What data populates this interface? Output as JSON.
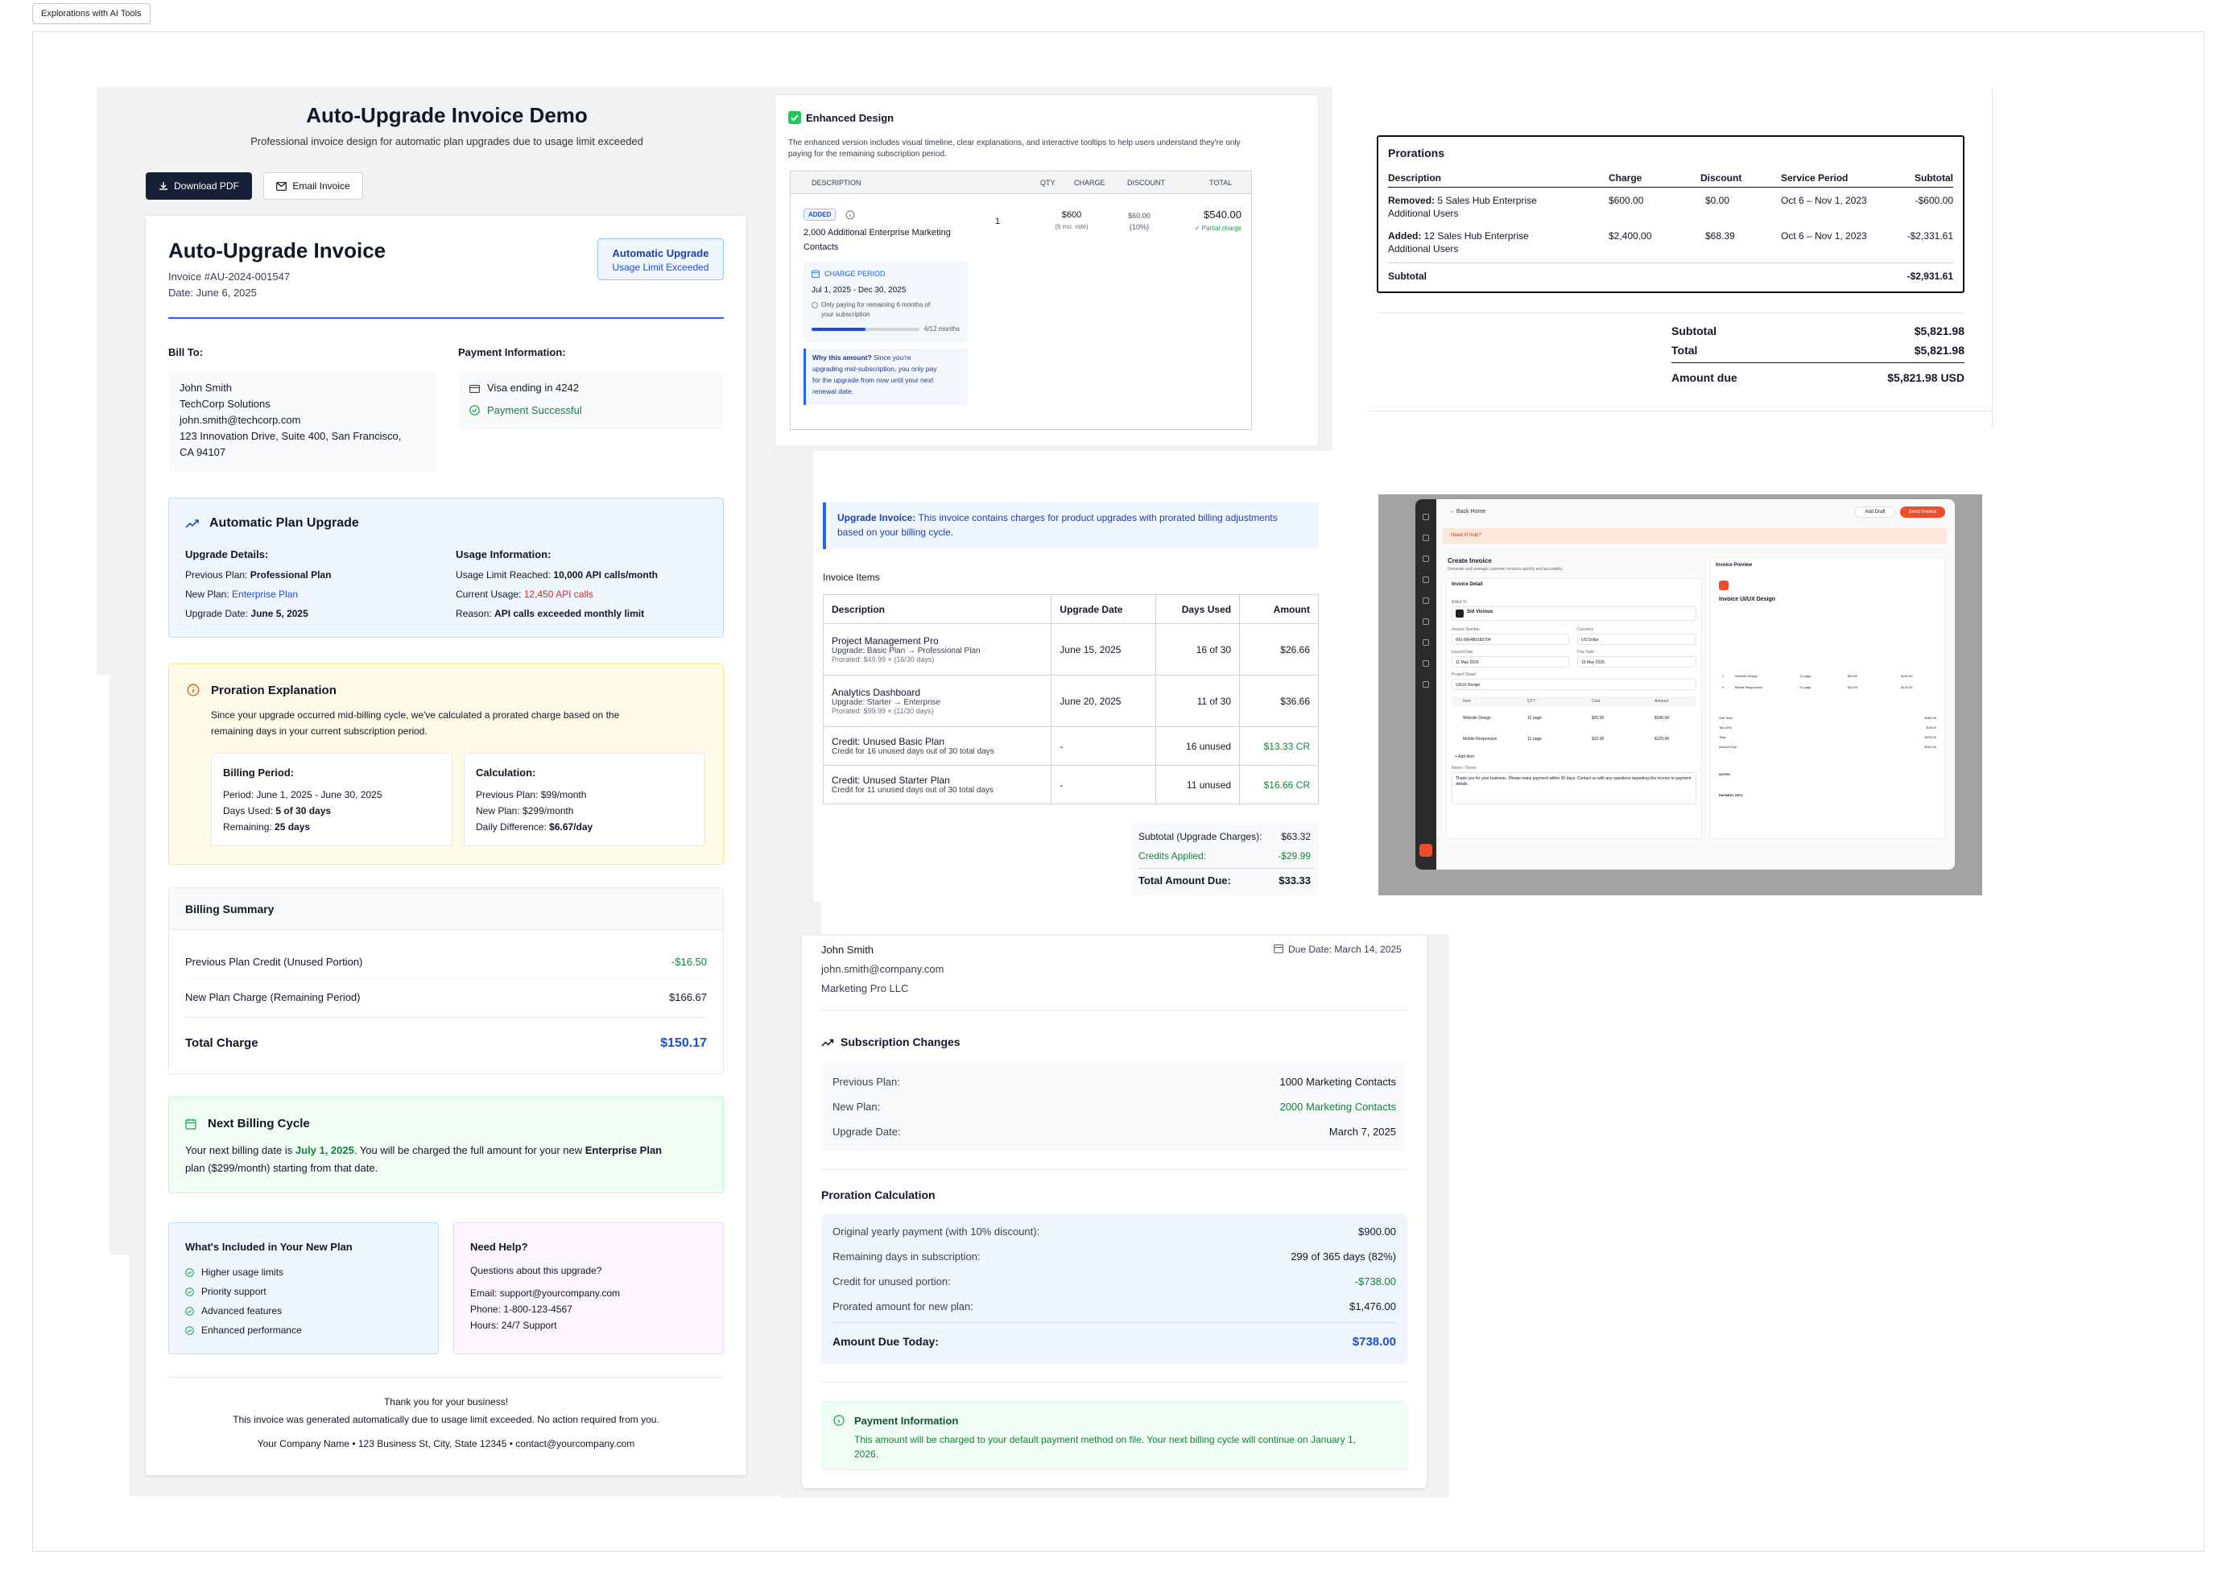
{
  "canvas": {
    "tag": "Explorations with AI Tools"
  },
  "left_invoice": {
    "demo_title": "Auto-Upgrade Invoice Demo",
    "demo_subtitle": "Professional invoice design for automatic plan upgrades due to usage limit exceeded",
    "download_label": "Download PDF",
    "email_label": "Email Invoice",
    "title": "Auto-Upgrade Invoice",
    "invoice_no": "Invoice #AU-2024-001547",
    "date": "Date: June 6, 2025",
    "badge_line1": "Automatic Upgrade",
    "badge_line2": "Usage Limit Exceeded",
    "bill_to_label": "Bill To:",
    "bill_to": [
      "John Smith",
      "TechCorp Solutions",
      "john.smith@techcorp.com",
      "123 Innovation Drive, Suite 400, San Francisco,",
      "CA 94107"
    ],
    "payment_label": "Payment Information:",
    "card": "Visa ending in 4242",
    "payment_status": "Payment Successful",
    "upgrade_title": "Automatic Plan Upgrade",
    "upgrade_details_label": "Upgrade Details:",
    "prev_plan_k": "Previous Plan:",
    "prev_plan_v": "Professional Plan",
    "new_plan_k": "New Plan:",
    "new_plan_v": "Enterprise Plan",
    "upgrade_date_k": "Upgrade Date:",
    "upgrade_date_v": "June 5, 2025",
    "usage_label": "Usage Information:",
    "limit_k": "Usage Limit Reached:",
    "limit_v": "10,000 API calls/month",
    "current_k": "Current Usage:",
    "current_v": "12,450 API calls",
    "reason_k": "Reason:",
    "reason_v": "API calls exceeded monthly limit",
    "proration_title": "Proration Explanation",
    "proration_text1": "Since your upgrade occurred mid-billing cycle, we've calculated a prorated charge based on the",
    "proration_text2": "remaining days in your current subscription period.",
    "billing_period_label": "Billing Period:",
    "period_k": "Period:",
    "period_v": "June 1, 2025 - June 30, 2025",
    "days_used_k": "Days Used:",
    "days_used_v": "5 of 30 days",
    "remaining_k": "Remaining:",
    "remaining_v": "25 days",
    "calc_label": "Calculation:",
    "calc_prev_k": "Previous Plan:",
    "calc_prev_v": "$99/month",
    "calc_new_k": "New Plan:",
    "calc_new_v": "$299/month",
    "calc_diff_k": "Daily Difference:",
    "calc_diff_v": "$6.67/day",
    "summary_title": "Billing Summary",
    "credit_k": "Previous Plan Credit (Unused Portion)",
    "credit_v": "-$16.50",
    "charge_k": "New Plan Charge (Remaining Period)",
    "charge_v": "$166.67",
    "total_k": "Total Charge",
    "total_v": "$150.17",
    "next_title": "Next Billing Cycle",
    "next_text_a": "Your next billing date is ",
    "next_date": "July 1, 2025",
    "next_text_b": ". You will be charged the full amount for your new ",
    "next_plan": "Enterprise Plan",
    "next_text_c": "plan ($299/month) starting from that date.",
    "included_title": "What's Included in Your New Plan",
    "included": [
      "Higher usage limits",
      "Priority support",
      "Advanced features",
      "Enhanced performance"
    ],
    "help_title": "Need Help?",
    "help_q": "Questions about this upgrade?",
    "help_email_k": "Email:",
    "help_email_v": "support@yourcompany.com",
    "help_phone_k": "Phone:",
    "help_phone_v": "1-800-123-4567",
    "help_hours_k": "Hours:",
    "help_hours_v": "24/7 Support",
    "thanks": "Thank you for your business!",
    "footer_note": "This invoice was generated automatically due to usage limit exceeded. No action required from you.",
    "footer_company": "Your Company Name • 123 Business St, City, State 12345 • contact@yourcompany.com"
  },
  "enhanced": {
    "title": "Enhanced Design",
    "desc1": "The enhanced version includes visual timeline, clear explanations, and interactive tooltips to help users understand they're only",
    "desc2": "paying for the remaining subscription period.",
    "headers": [
      "DESCRIPTION",
      "QTY",
      "CHARGE",
      "DISCOUNT",
      "TOTAL"
    ],
    "badge": "ADDED",
    "item1": "2,000 Additional Enterprise Marketing",
    "item2": "Contacts",
    "qty": "1",
    "charge": "$600",
    "charge_sub": "(6 mo. rate)",
    "discount": "$60.00",
    "discount_sub": "(10%)",
    "total": "$540.00",
    "partial": "✓ Partial charge",
    "period_label": "CHARGE PERIOD",
    "period": "Jul 1, 2025 - Dec 30, 2025",
    "period_note1": "Only paying for remaining 6 months of",
    "period_note2": "your subscription",
    "progress_label": "6/12 months",
    "progress": 0.5,
    "why_bold": "Why this amount?",
    "why1": " Since you're",
    "why2": "upgrading mid-subscription, you only pay",
    "why3": "for the upgrade from now until your next",
    "why4": "renewal date."
  },
  "prorations": {
    "title": "Prorations",
    "headers": [
      "Description",
      "Charge",
      "Discount",
      "Service Period",
      "Subtotal"
    ],
    "rows": [
      {
        "kind": "Removed:",
        "desc1": " 5 Sales Hub Enterprise",
        "desc2": "Additional Users",
        "charge": "$600.00",
        "discount": "$0.00",
        "period": "Oct 6 – Nov 1, 2023",
        "subtotal": "-$600.00"
      },
      {
        "kind": "Added:",
        "desc1": " 12 Sales Hub Enterprise",
        "desc2": "Additional Users",
        "charge": "$2,400.00",
        "discount": "$68.39",
        "period": "Oct 6 – Nov 1, 2023",
        "subtotal": "-$2,331.61"
      }
    ],
    "subtotal_k": "Subtotal",
    "subtotal_v": "-$2,931.61",
    "sum_subtotal_k": "Subtotal",
    "sum_subtotal_v": "$5,821.98",
    "sum_total_k": "Total",
    "sum_total_v": "$5,821.98",
    "amount_due_k": "Amount due",
    "amount_due_v": "$5,821.98 USD"
  },
  "upgrade_table": {
    "banner_bold": "Upgrade Invoice:",
    "banner1": " This invoice contains charges for product upgrades with prorated billing adjustments",
    "banner2": "based on your billing cycle.",
    "items_label": "Invoice Items",
    "headers": [
      "Description",
      "Upgrade Date",
      "Days Used",
      "Amount"
    ],
    "rows": [
      {
        "name": "Project Management Pro",
        "sub1": "Upgrade: Basic Plan → Professional Plan",
        "sub2": "Prorated: $49.99 × (16/30 days)",
        "date": "June 15, 2025",
        "days": "16 of 30",
        "amount": "$26.66",
        "credit": false
      },
      {
        "name": "Analytics Dashboard",
        "sub1": "Upgrade: Starter → Enterprise",
        "sub2": "Prorated: $99.99 × (11/30 days)",
        "date": "June 20, 2025",
        "days": "11 of 30",
        "amount": "$36.66",
        "credit": false
      },
      {
        "name": "Credit: Unused Basic Plan",
        "sub1": "Credit for 16 unused days out of 30 total days",
        "sub2": "",
        "date": "-",
        "days": "16 unused",
        "amount": "$13.33 CR",
        "credit": true
      },
      {
        "name": "Credit: Unused Starter Plan",
        "sub1": "Credit for 11 unused days out of 30 total days",
        "sub2": "",
        "date": "-",
        "days": "11 unused",
        "amount": "$16.66 CR",
        "credit": true
      }
    ],
    "subtotal_k": "Subtotal (Upgrade Charges):",
    "subtotal_v": "$63.32",
    "credits_k": "Credits Applied:",
    "credits_v": "-$29.99",
    "total_k": "Total Amount Due:",
    "total_v": "$33.33"
  },
  "mock_app": {
    "back": "← Back Home",
    "add_draft": "Add Draft",
    "send": "Send Invoice",
    "ai_help": "Need AI help?",
    "create_title": "Create Invoice",
    "create_sub": "Generate and manage customer invoices quickly and accurately.",
    "invoice_detail": "Invoice Detail",
    "billed_to": "Billed To",
    "client": "Sid Vicious",
    "invoice_number_k": "Invoice Number",
    "invoice_number_v": "INV-0064B9182704",
    "currency_k": "Currency",
    "currency_v": "US Dollar",
    "issued_k": "Issued Date",
    "issued_v": "11 May 2025",
    "due_k": "Due Date",
    "due_v": "15 May 2025",
    "project_k": "Project Detail",
    "project_v": "UI/UX Design",
    "item_headers": [
      "Item",
      "QTY",
      "Cost",
      "Amount"
    ],
    "items": [
      [
        "Website Design",
        "12 page",
        "$20.00",
        "$240.00"
      ],
      [
        "Mobile Responsive",
        "12 page",
        "$10.00",
        "$120.00"
      ]
    ],
    "add_item": "+ Add Item",
    "notes_k": "Notes / Terms",
    "notes_v": "Thank you for your business. Please make payment within 30 days. Contact us with any questions regarding this invoice or payment details.",
    "preview_title": "Invoice Preview",
    "preview_heading": "Invoice UI/UX Design",
    "preview_items": [
      [
        "1",
        "Website Design",
        "12 page",
        "$20.00",
        "$240.00"
      ],
      [
        "2",
        "Mobile Responsive",
        "12 page",
        "$10.00",
        "$120.00"
      ]
    ],
    "preview_totals": [
      [
        "Sub Total",
        "$360.00"
      ],
      [
        "Tax (5%)",
        "$18.00"
      ],
      [
        "Total",
        "$378.00"
      ],
      [
        "Amount Due",
        "$342.00"
      ]
    ],
    "preview_notes": "NOTES",
    "preview_payment": "PAYMENT INFO"
  },
  "subscription": {
    "name": "John Smith",
    "email": "john.smith@company.com",
    "company": "Marketing Pro LLC",
    "due": "Due Date: March 14, 2025",
    "changes_title": "Subscription Changes",
    "prev_k": "Previous Plan:",
    "prev_v": "1000 Marketing Contacts",
    "new_k": "New Plan:",
    "new_v": "2000 Marketing Contacts",
    "date_k": "Upgrade Date:",
    "date_v": "March 7, 2025",
    "calc_title": "Proration Calculation",
    "orig_k": "Original yearly payment (with 10% discount):",
    "orig_v": "$900.00",
    "remain_k": "Remaining days in subscription:",
    "remain_v": "299 of 365 days (82%)",
    "credit_k": "Credit for unused portion:",
    "credit_v": "-$738.00",
    "prorated_k": "Prorated amount for new plan:",
    "prorated_v": "$1,476.00",
    "due_k": "Amount Due Today:",
    "due_v": "$738.00",
    "pay_title": "Payment Information",
    "pay_text1": "This amount will be charged to your default payment method on file. Your next billing cycle will continue on January 1,",
    "pay_text2": "2026."
  },
  "colors": {
    "accent": "#1d4ed8",
    "dark": "#172036",
    "green": "#15803d",
    "red": "#dc2626",
    "orange": "#ef4d2c"
  }
}
